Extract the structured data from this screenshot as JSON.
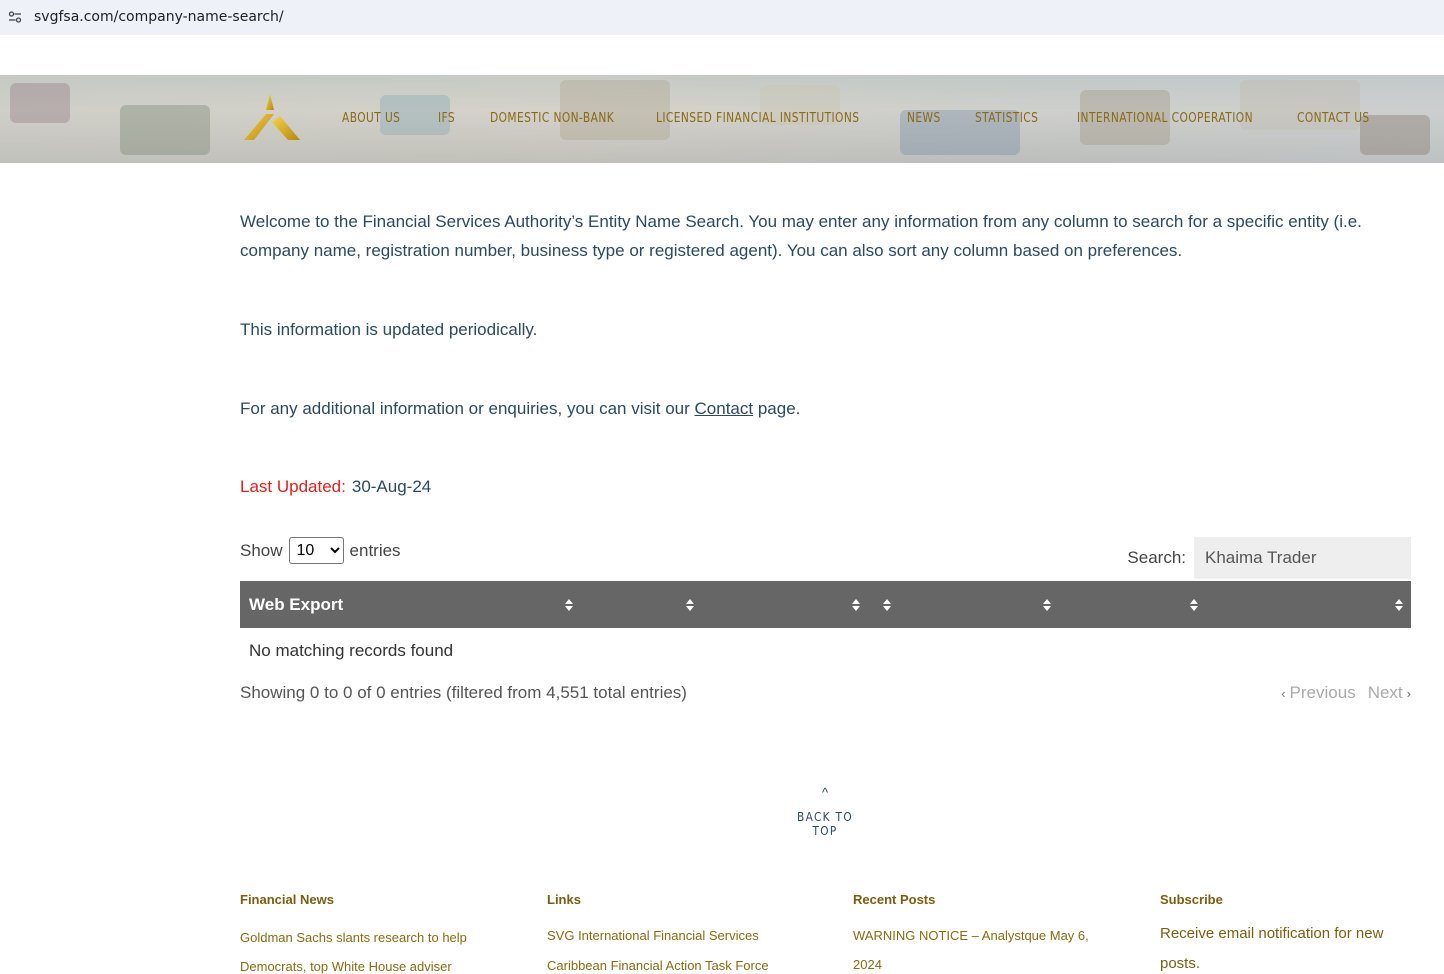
{
  "browser": {
    "url": "svgfsa.com/company-name-search/",
    "site_icon": "tune-icon"
  },
  "nav": {
    "items": [
      {
        "label": "ABOUT US"
      },
      {
        "label": "IFS"
      },
      {
        "label": "DOMESTIC NON-BANK"
      },
      {
        "label": "LICENSED FINANCIAL INSTITUTIONS"
      },
      {
        "label": "NEWS"
      },
      {
        "label": "STATISTICS"
      },
      {
        "label": "INTERNATIONAL COOPERATION"
      },
      {
        "label": "CONTACT US"
      }
    ]
  },
  "content": {
    "intro": "Welcome to the Financial Services Authority’s Entity Name Search. You may enter any information from any column to search for a specific entity (i.e. company name, registration number, business type or registered agent). You can also sort any column based on preferences.",
    "updated_note": "This information is updated periodically.",
    "contact_prefix": "For any additional information or enquiries, you can visit our ",
    "contact_link": "Contact",
    "contact_suffix": " page.",
    "last_updated_label": "Last Updated:",
    "last_updated_value": "30-Aug-24"
  },
  "table": {
    "show_label": "Show",
    "show_value": "10",
    "entries_label": "entries",
    "search_label": "Search:",
    "search_value": "Khaima Trader",
    "header_title": "Web Export",
    "empty_message": "No matching records found",
    "info": "Showing 0 to 0 of 0 entries (filtered from 4,551 total entries)",
    "previous_label": "Previous",
    "next_label": "Next"
  },
  "back_to_top": "BACK TO TOP",
  "footer": {
    "financial_news": {
      "heading": "Financial News",
      "items": [
        "Goldman Sachs slants research to help",
        "Democrats, top White House adviser"
      ]
    },
    "links": {
      "heading": "Links",
      "items": [
        "SVG International Financial Services",
        "Caribbean Financial Action Task Force"
      ]
    },
    "recent_posts": {
      "heading": "Recent Posts",
      "items": [
        "WARNING NOTICE – Analystque May 6,",
        "2024"
      ]
    },
    "subscribe": {
      "heading": "Subscribe",
      "text_1": "Receive email notification for new",
      "text_2": "posts."
    }
  },
  "colors": {
    "nav_text": "#8a6a12",
    "body_text": "#2b4a5f",
    "table_header": "#666666",
    "last_updated_label": "#e02020"
  }
}
